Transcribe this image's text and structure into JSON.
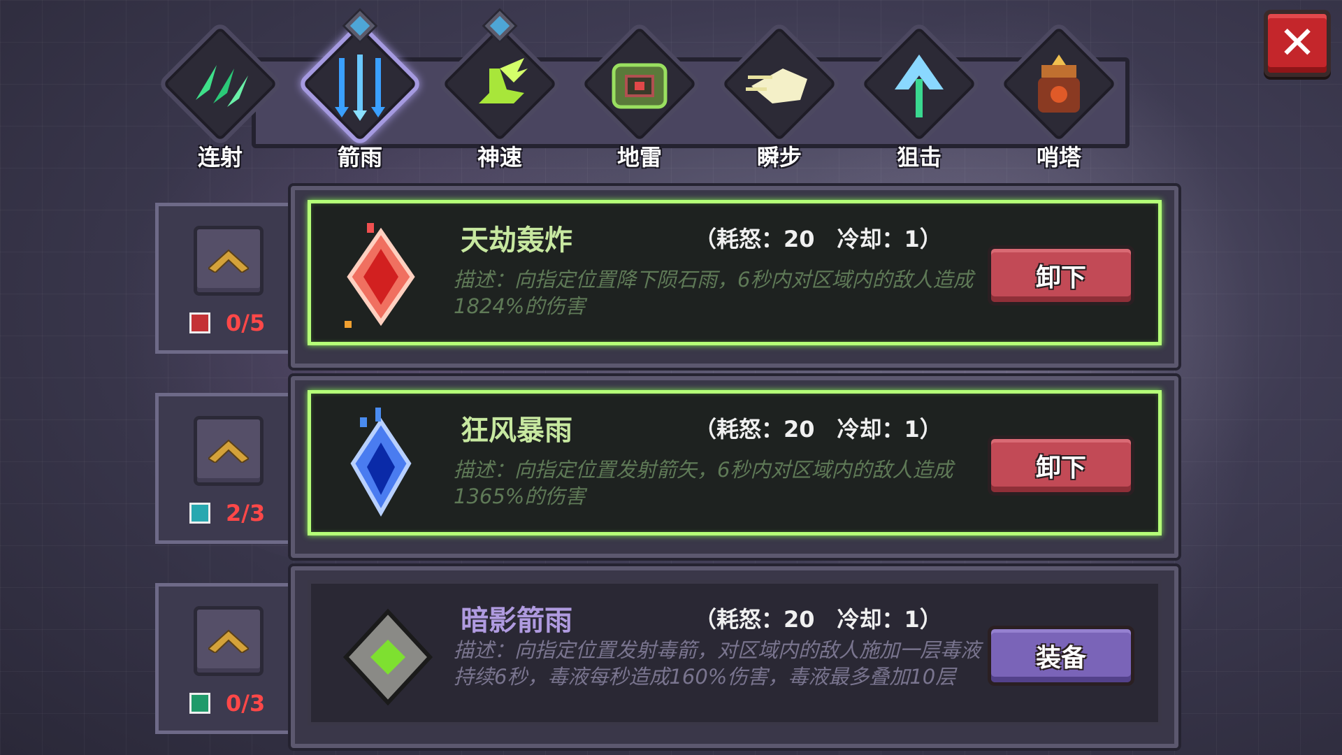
{
  "colors": {
    "active_border": "#b5ff78",
    "close_red": "#c4262b",
    "unequip_button": "#c24a56",
    "equip_button": "#7a64b8",
    "count_red": "#ff4848"
  },
  "close_button": {
    "label": "✕",
    "icon": "close-icon"
  },
  "tabs": [
    {
      "label": "连射",
      "icon": "rapid-fire-icon",
      "active": false,
      "marker": false
    },
    {
      "label": "箭雨",
      "icon": "arrow-rain-icon",
      "active": true,
      "marker": true
    },
    {
      "label": "神速",
      "icon": "winged-boot-icon",
      "active": false,
      "marker": true
    },
    {
      "label": "地雷",
      "icon": "landmine-icon",
      "active": false,
      "marker": false
    },
    {
      "label": "瞬步",
      "icon": "dash-icon",
      "active": false,
      "marker": false
    },
    {
      "label": "狙击",
      "icon": "snipe-arrow-icon",
      "active": false,
      "marker": false
    },
    {
      "label": "哨塔",
      "icon": "turret-icon",
      "active": false,
      "marker": false
    }
  ],
  "upgrades": [
    {
      "count": "0/5",
      "book": "red-book-icon"
    },
    {
      "count": "2/3",
      "book": "teal-book-icon"
    },
    {
      "count": "0/3",
      "book": "green-book-icon"
    }
  ],
  "skills": [
    {
      "name": "天劫轰炸",
      "cost": "（耗怒：20　冷却：1）",
      "description": "描述：向指定位置降下陨石雨，6秒内对区域内的敌人造成1824%的伤害",
      "button": "卸下",
      "equipped": true,
      "icon": "red-crystal-icon"
    },
    {
      "name": "狂风暴雨",
      "cost": "（耗怒：20　冷却：1）",
      "description": "描述：向指定位置发射箭矢，6秒内对区域内的敌人造成1365%的伤害",
      "button": "卸下",
      "equipped": true,
      "icon": "blue-crystal-icon"
    },
    {
      "name": "暗影箭雨",
      "cost": "（耗怒：20　冷却：1）",
      "description": "描述：向指定位置发射毒箭，对区域内的敌人施加一层毒液持续6秒，毒液每秒造成160%伤害，毒液最多叠加10层",
      "button": "装备",
      "equipped": false,
      "icon": "green-gem-icon"
    }
  ]
}
